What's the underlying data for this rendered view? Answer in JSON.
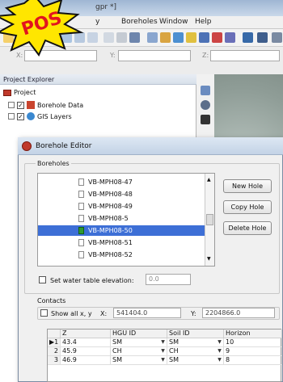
{
  "window": {
    "title_visible": "gpr *]",
    "menu": [
      "y",
      "Boreholes",
      "Window",
      "Help"
    ],
    "coord_labels": [
      "X:",
      "Y:",
      "Z:"
    ]
  },
  "burst_text": "POS",
  "explorer": {
    "title": "Project Explorer",
    "root": "Project",
    "children": [
      "Borehole Data",
      "GIS Layers"
    ]
  },
  "dialog": {
    "title": "Borehole Editor",
    "boreholes_label": "Boreholes",
    "holes": [
      "VB-MPH08-47",
      "VB-MPH08-48",
      "VB-MPH08-49",
      "VB-MPH08-5",
      "VB-MPH08-50",
      "VB-MPH08-51",
      "VB-MPH08-52"
    ],
    "selected_index": 4,
    "buttons": {
      "new": "New Hole",
      "copy": "Copy Hole",
      "delete": "Delete Hole"
    },
    "water_label": "Set water table elevation:",
    "water_value": "0.0",
    "contacts_label": "Contacts",
    "show_all_label": "Show all x, y",
    "x_label": "X:",
    "x_value": "541404.0",
    "y_label": "Y:",
    "y_value": "2204866.0",
    "table": {
      "headers": [
        "Z",
        "HGU ID",
        "Soil ID",
        "Horizon"
      ],
      "rows": [
        {
          "n": "1",
          "z": "43.4",
          "hgu": "SM",
          "soil": "SM",
          "horizon": "10",
          "current": true
        },
        {
          "n": "2",
          "z": "45.9",
          "hgu": "CH",
          "soil": "CH",
          "horizon": "9",
          "current": false
        },
        {
          "n": "3",
          "z": "46.9",
          "hgu": "SM",
          "soil": "SM",
          "horizon": "8",
          "current": false
        }
      ]
    }
  }
}
